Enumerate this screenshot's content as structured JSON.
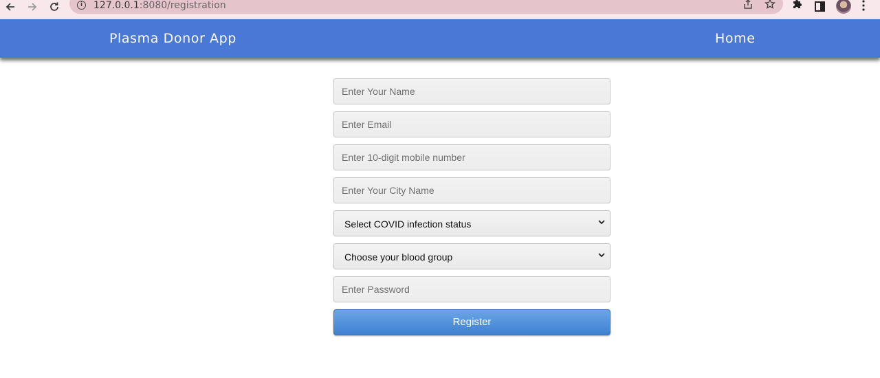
{
  "browser": {
    "url_host": "127.0.0.1",
    "url_rest": ":8080/registration"
  },
  "navbar": {
    "brand": "Plasma Donor App",
    "home": "Home",
    "color": "#4a78d6"
  },
  "form": {
    "name_placeholder": "Enter Your Name",
    "email_placeholder": "Enter Email",
    "mobile_placeholder": "Enter 10-digit mobile number",
    "city_placeholder": "Enter Your City Name",
    "covid_select": "Select COVID infection status",
    "blood_select": "Choose your blood group",
    "password_placeholder": "Enter Password",
    "register_label": "Register"
  },
  "icons": [
    "back-arrow-icon",
    "forward-arrow-icon",
    "reload-icon",
    "info-icon",
    "share-icon",
    "star-icon",
    "puzzle-icon",
    "side-panel-icon",
    "profile-avatar",
    "kebab-menu-icon",
    "chevron-down-icon"
  ]
}
